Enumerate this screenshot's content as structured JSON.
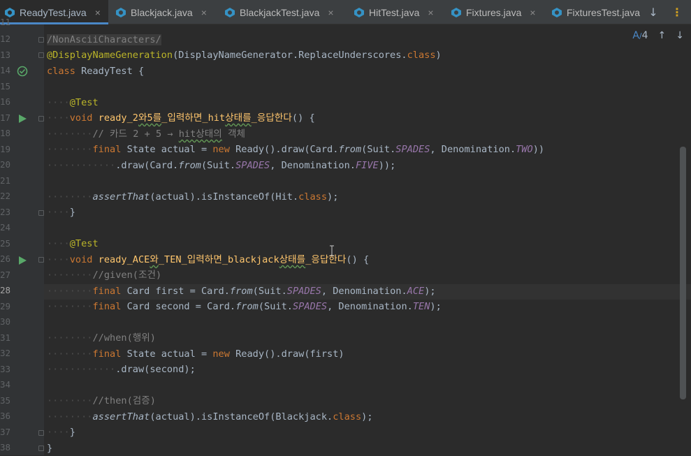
{
  "tabs": [
    {
      "label": "ReadyTest.java",
      "active": true,
      "icon": "java-class-icon",
      "close": "×"
    },
    {
      "label": "Blackjack.java",
      "active": false,
      "icon": "java-class-icon",
      "close": "×"
    },
    {
      "label": "BlackjackTest.java",
      "active": false,
      "icon": "java-class-icon",
      "close": "×"
    },
    {
      "label": "HitTest.java",
      "active": false,
      "icon": "java-class-icon",
      "close": "×"
    },
    {
      "label": "Fixtures.java",
      "active": false,
      "icon": "java-class-icon",
      "close": "×"
    },
    {
      "label": "FixturesTest.java",
      "active": false,
      "icon": "java-class-icon",
      "close": ""
    }
  ],
  "tab_actions": {
    "more_icon": "↓",
    "menu_icon": "⋮"
  },
  "inspections": {
    "count": "4",
    "up_icon": "↑",
    "down_icon": "↓",
    "spell_icon": "A"
  },
  "line_numbers": [
    "11",
    "12",
    "13",
    "14",
    "15",
    "16",
    "17",
    "18",
    "19",
    "20",
    "21",
    "22",
    "23",
    "24",
    "25",
    "26",
    "27",
    "28",
    "29",
    "30",
    "31",
    "32",
    "33",
    "34",
    "35",
    "36",
    "37",
    "38"
  ],
  "current_line": "28",
  "code": {
    "l12": "/NonAsciiCharacters/",
    "l13_ann": "@DisplayNameGeneration",
    "l13_a": "(DisplayNameGenerator.ReplaceUnderscores.",
    "l13_kw": "class",
    "l13_b": ")",
    "l14_kw": "class",
    "l14_rest": " ReadyTest {",
    "l16": "@Test",
    "l17_kw": "void",
    "l17_fn_a": "ready_2",
    "l17_fn_b": "와5를",
    "l17_fn_c": "_입력하면_hit",
    "l17_fn_d": "상태를",
    "l17_fn_e": "_응답한다",
    "l17_rest": "() {",
    "l18_a": "// 카드 2 + 5 → ",
    "l18_b": "hit상태의",
    "l18_c": " 객체",
    "l19_kw1": "final",
    "l19_a": " State actual = ",
    "l19_kw2": "new",
    "l19_b": " Ready().draw(Card.",
    "l19_from": "from",
    "l19_c": "(Suit.",
    "l19_st1": "SPADES",
    "l19_d": ", Denomination.",
    "l19_st2": "TWO",
    "l19_e": "))",
    "l20_a": ".draw(Card.",
    "l20_from": "from",
    "l20_b": "(Suit.",
    "l20_st1": "SPADES",
    "l20_c": ", Denomination.",
    "l20_st2": "FIVE",
    "l20_d": "));",
    "l22_it": "assertThat",
    "l22_a": "(actual).isInstanceOf(Hit.",
    "l22_kw": "class",
    "l22_b": ");",
    "l23": "}",
    "l25": "@Test",
    "l26_kw": "void",
    "l26_fn_a": "ready_ACE",
    "l26_fn_b": "와",
    "l26_fn_c": "_TEN_입력하면_blackjack",
    "l26_fn_d": "상태를",
    "l26_fn_e": "_응답한다",
    "l26_rest": "() {",
    "l27": "//given(조건)",
    "l28_kw": "final",
    "l28_a": " Card first = Card.",
    "l28_from": "from",
    "l28_b": "(Suit.",
    "l28_st1": "SPADES",
    "l28_c": ", Denomination.",
    "l28_st2": "ACE",
    "l28_d": ");",
    "l29_kw": "final",
    "l29_a": " Card second = Card.",
    "l29_from": "from",
    "l29_b": "(Suit.",
    "l29_st1": "SPADES",
    "l29_c": ", Denomination.",
    "l29_st2": "TEN",
    "l29_d": ");",
    "l31": "//when(행위)",
    "l32_kw1": "final",
    "l32_a": " State actual = ",
    "l32_kw2": "new",
    "l32_b": " Ready().draw(first)",
    "l33": ".draw(second);",
    "l35": "//then(검증)",
    "l36_it": "assertThat",
    "l36_a": "(actual).isInstanceOf(Blackjack.",
    "l36_kw": "class",
    "l36_b": ");",
    "l37": "}",
    "l38": "}"
  },
  "colors": {
    "background": "#2b2b2b",
    "keyword": "#cc7832",
    "annotation": "#bbb529",
    "function": "#ffc66d",
    "static": "#9876aa",
    "comment": "#808080",
    "tab_accent": "#4a88c7",
    "run_icon": "#59a869"
  }
}
